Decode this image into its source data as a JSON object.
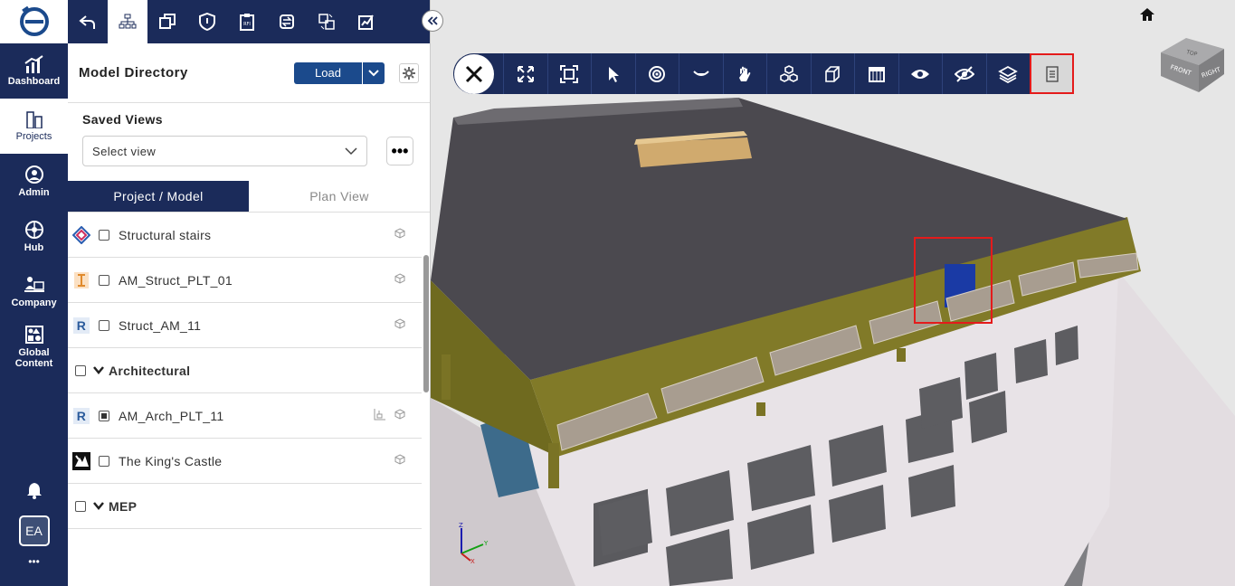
{
  "nav": {
    "items": [
      {
        "label": "Dashboard",
        "icon": "dashboard-icon"
      },
      {
        "label": "Projects",
        "icon": "projects-icon"
      },
      {
        "label": "Admin",
        "icon": "admin-icon"
      },
      {
        "label": "Hub",
        "icon": "hub-icon"
      },
      {
        "label": "Company",
        "icon": "company-icon"
      },
      {
        "label": "Global Content",
        "icon": "global-content-icon"
      }
    ],
    "avatar": "EA",
    "more": "•••"
  },
  "panel": {
    "directory_title": "Model Directory",
    "load_label": "Load",
    "saved_views_title": "Saved Views",
    "select_placeholder": "Select view",
    "more_label": "•••",
    "tabs": [
      {
        "label": "Project / Model",
        "active": true
      },
      {
        "label": "Plan View",
        "active": false
      }
    ],
    "rows": [
      {
        "name": "Structural stairs",
        "type": "model"
      },
      {
        "name": "AM_Struct_PLT_01",
        "type": "model"
      },
      {
        "name": "Struct_AM_11",
        "type": "model"
      },
      {
        "name": "Architectural",
        "type": "group"
      },
      {
        "name": "AM_Arch_PLT_11",
        "type": "model",
        "checked": true
      },
      {
        "name": "The King's Castle",
        "type": "model"
      },
      {
        "name": "MEP",
        "type": "group"
      }
    ]
  },
  "viewer": {
    "cube_labels": {
      "front": "FRONT",
      "right": "RIGHT",
      "top": "TOP"
    },
    "axes": {
      "x": "X",
      "y": "Y",
      "z": "Z"
    },
    "colors": {
      "accent": "#1b2b5a",
      "highlight": "#e41b1b"
    }
  }
}
